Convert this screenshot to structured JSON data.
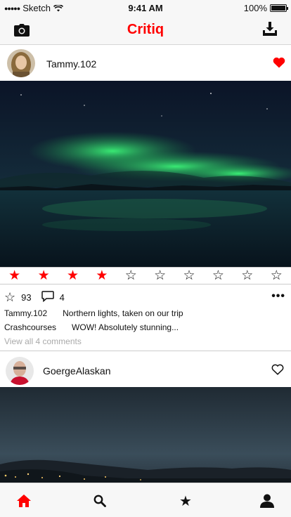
{
  "status_bar": {
    "carrier": "Sketch",
    "time": "9:41 AM",
    "battery": "100%",
    "battery_level": 1.0
  },
  "nav": {
    "title": "Critiq",
    "left_icon": "camera-icon",
    "right_icon": "download-icon"
  },
  "posts": [
    {
      "username": "Tammy.102",
      "liked": true,
      "rating": 4,
      "max_rating": 10,
      "stars_count": "93",
      "comments_count": "4",
      "caption_user": "Tammy.102",
      "caption_text": "Northern lights, taken on our trip",
      "comment_user": "Crashcourses",
      "comment_text": "WOW! Absolutely stunning...",
      "view_all": "View all 4 comments"
    },
    {
      "username": "GoergeAlaskan",
      "liked": false
    }
  ],
  "tab_bar": {
    "items": [
      "home-icon",
      "search-icon",
      "star-icon",
      "profile-icon"
    ],
    "active": "home-icon"
  },
  "colors": {
    "accent": "#ff0000",
    "bar_background": "#f7f7f7"
  }
}
